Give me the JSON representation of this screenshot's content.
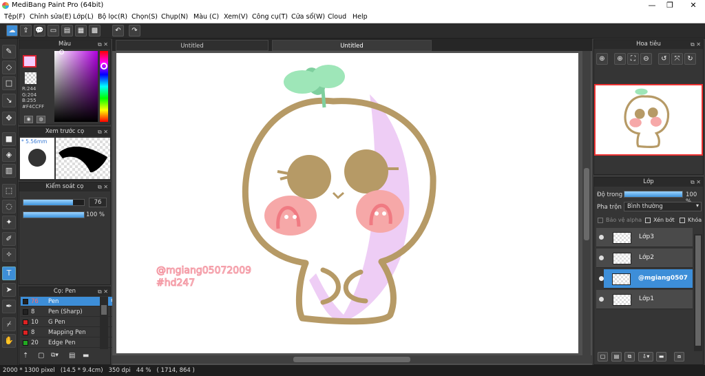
{
  "window": {
    "title": "MediBang Paint Pro (64bit)",
    "min": "—",
    "max": "❐",
    "close": "✕"
  },
  "menu": [
    "Tệp(F)",
    "Chỉnh sửa(E)",
    "Lớp(L)",
    "Bộ lọc(R)",
    "Chọn(S)",
    "Chụp(N)",
    "Màu (C)",
    "Xem(V)",
    "Công cụ(T)",
    "Cửa sổ(W)",
    "Cloud",
    "Help"
  ],
  "toolbar": {
    "icons": [
      "cloud-icon",
      "export-icon",
      "speech-icon",
      "comment-icon",
      "page-icon",
      "panels-icon",
      "grid-icon",
      "undo-icon",
      "redo-icon"
    ]
  },
  "color_panel": {
    "title": "Màu",
    "foreground": "#F4CCFF",
    "r_label": "R:244",
    "g_label": "G:204",
    "b_label": "B:255",
    "hex_label": "#F4CCFF"
  },
  "brush_preview": {
    "title": "Xem trước cọ",
    "size": "* 5.56mm"
  },
  "brush_control": {
    "title": "Kiểm soát cọ",
    "size_value": "76",
    "size_fraction": 0.82,
    "opacity_value": "100 %",
    "opacity_fraction": 1.0
  },
  "brush_list": {
    "title": "Cọ: Pen",
    "items": [
      {
        "size": "76",
        "name": "Pen",
        "color": "#222222"
      },
      {
        "size": "8",
        "name": "Pen (Sharp)",
        "color": "#222222"
      },
      {
        "size": "10",
        "name": "G Pen",
        "color": "#dd2222"
      },
      {
        "size": "8",
        "name": "Mapping Pen",
        "color": "#dd2222"
      },
      {
        "size": "20",
        "name": "Edge Pen",
        "color": "#22aa22"
      }
    ]
  },
  "tabs": [
    "Untitled",
    "Untitled"
  ],
  "artwork": {
    "watermark_line1": "@mgiang05072009",
    "watermark_line2": "#hd247"
  },
  "navigator": {
    "title": "Hoa tiêu"
  },
  "layer_panel": {
    "title": "Lớp",
    "opacity_label": "Độ trong",
    "opacity_value": "100 %",
    "opacity_fraction": 1.0,
    "blend_label": "Pha trộn",
    "blend_value": "Bình thường",
    "protect_alpha": "Bảo vệ alpha",
    "clipping": "Xén bớt",
    "lock": "Khóa",
    "layers": [
      {
        "name": "Lớp3"
      },
      {
        "name": "Lớp2"
      },
      {
        "name": "@mgiang0507"
      },
      {
        "name": "Lớp1"
      }
    ]
  },
  "status": {
    "text": "2000 * 1300 pixel   (14.5 * 9.4cm)   350 dpi   44 %   ( 1714, 864 )"
  }
}
